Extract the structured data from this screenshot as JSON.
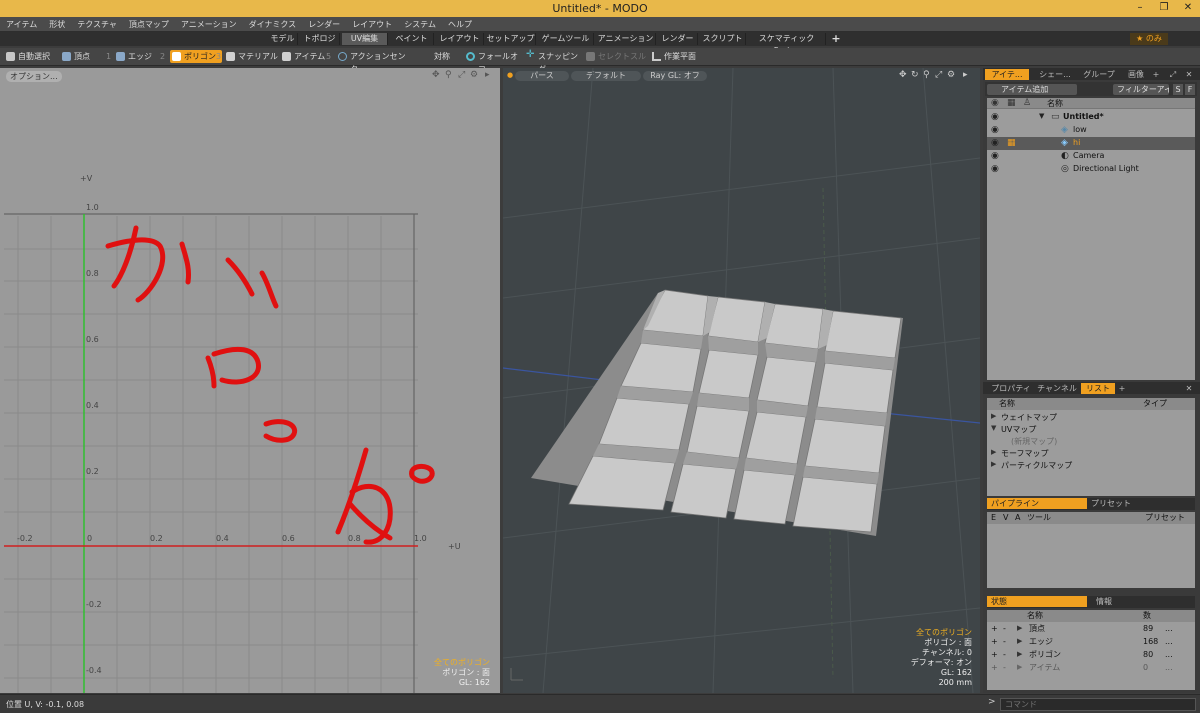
{
  "window": {
    "title": "Untitled* - MODO",
    "minimize": "–",
    "restore": "❐",
    "close": "✕"
  },
  "menu": [
    "アイテム",
    "形状",
    "テクスチャ",
    "頂点マップ",
    "アニメーション",
    "ダイナミクス",
    "レンダー",
    "レイアウト",
    "システム",
    "ヘルプ"
  ],
  "layout_tabs": [
    "モデル",
    "トポロジ",
    "UV編集",
    "ペイント",
    "レイアウト",
    "セットアップ",
    "ゲームツール",
    "アニメーション",
    "レンダー",
    "スクリプト",
    "スケマティックFusion"
  ],
  "layout_tab_add": "+",
  "only_badge": "★ のみ",
  "toolbar": {
    "auto_select": "自動選択",
    "vertex": "頂点",
    "vertex_key": "1",
    "edge": "エッジ",
    "edge_key": "2",
    "polygon": "ポリゴン",
    "polygon_key": "3",
    "material": "マテリアル",
    "item": "アイテム",
    "item_key": "5",
    "action_center": "アクションセンター",
    "symmetry": "対称",
    "falloff": "フォールオフ",
    "snapping": "スナッピング",
    "select_through": "セレクトスルー",
    "work_plane": "作業平面"
  },
  "uv_view": {
    "options_label": "オプション...",
    "plus_v": "+V",
    "plus_u": "+U",
    "v_labels": [
      "1.0",
      "0.8",
      "0.6",
      "0.4",
      "0.2",
      "-0.2",
      "-0.4"
    ],
    "u_labels": [
      "-0.2",
      "0",
      "0.2",
      "0.4",
      "0.6",
      "0.8",
      "1.0"
    ],
    "overlay": {
      "line1": "全てのポリゴン",
      "line2": "ポリゴン : 面",
      "line3": "GL: 162"
    }
  },
  "viewport3d": {
    "view_perspective": "パース",
    "view_default": "デフォルト",
    "view_raygl": "Ray GL: オフ",
    "overlay": {
      "line1": "全てのポリゴン",
      "line2": "ポリゴン : 面",
      "line3": "チャンネル: 0",
      "line4": "デフォーマ: オン",
      "line5": "GL: 162",
      "line6": "200 mm"
    }
  },
  "items_panel": {
    "tabs": [
      "アイテ...",
      "シェー...",
      "グループ",
      "画像"
    ],
    "add_item": "アイテム追加",
    "filter": "フィルターアイ...",
    "s_btn": "S",
    "f_btn": "F",
    "col_name": "名称",
    "items": [
      {
        "name": "Untitled*",
        "level": 0,
        "bold": true,
        "selected": false
      },
      {
        "name": "low",
        "level": 1,
        "bold": false,
        "selected": false
      },
      {
        "name": "hi",
        "level": 1,
        "bold": false,
        "selected": true
      },
      {
        "name": "Camera",
        "level": 1,
        "bold": false,
        "selected": false
      },
      {
        "name": "Directional Light",
        "level": 1,
        "bold": false,
        "selected": false
      }
    ]
  },
  "list_panel": {
    "tabs": [
      "プロパティ",
      "チャンネル",
      "リスト"
    ],
    "col_name": "名称",
    "col_type": "タイプ",
    "rows": [
      "ウェイトマップ",
      "UVマップ",
      "(新規マップ)",
      "モーフマップ",
      "パーティクルマップ"
    ]
  },
  "pipeline_panel": {
    "tabs": [
      "パイプライン",
      "プリセット"
    ],
    "cols": {
      "e": "E",
      "v": "V",
      "a": "A",
      "tool": "ツール",
      "preset": "プリセット"
    }
  },
  "stats_panel": {
    "tabs": [
      "状態",
      "情報"
    ],
    "col_name": "名称",
    "col_count": "数",
    "rows": [
      {
        "name": "頂点",
        "count": "89",
        "more": "..."
      },
      {
        "name": "エッジ",
        "count": "168",
        "more": "..."
      },
      {
        "name": "ポリゴン",
        "count": "80",
        "more": "..."
      },
      {
        "name": "アイテム",
        "count": "0",
        "more": "..."
      }
    ]
  },
  "statusbar": {
    "position": "位置 U, V:  -0.1, 0.08",
    "command_placeholder": "コマンド"
  },
  "colors": {
    "accent": "#f0a020",
    "titlebar": "#e8b84a",
    "uv_bg": "#9a9a9a",
    "viewport_bg": "#3f4548",
    "handwriting": "#e01010"
  }
}
